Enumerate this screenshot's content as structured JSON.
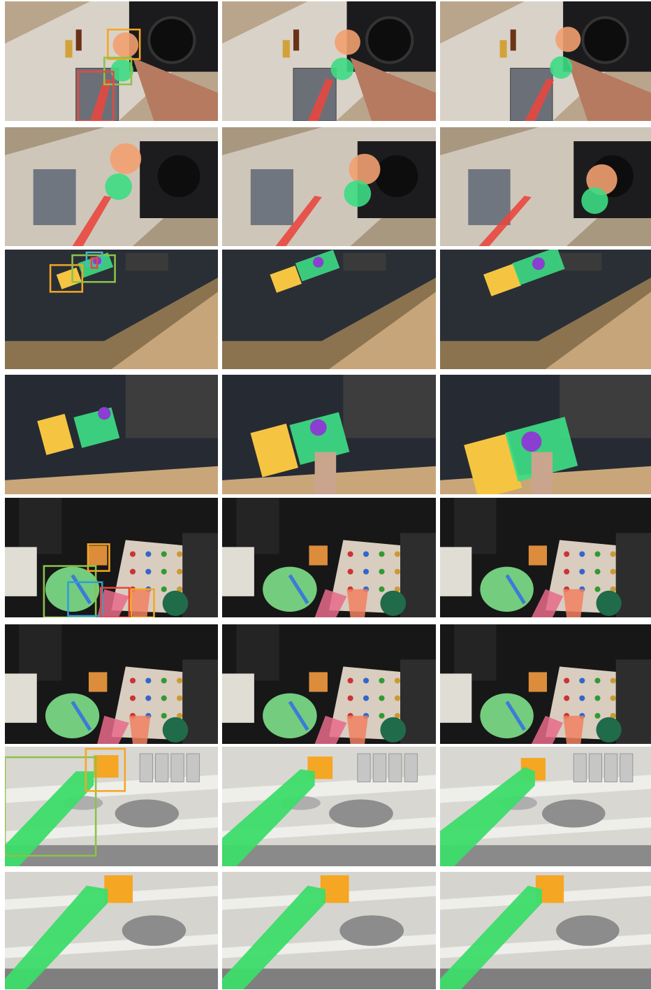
{
  "figure": {
    "rows": 8,
    "columns": 3,
    "description_rows": [
      {
        "scene": "stovetop-pan",
        "prompt_boxes": [
          "orange",
          "green",
          "red"
        ],
        "mask_colors": [
          "#f2a070",
          "#3ddc84",
          "#e8473f"
        ]
      },
      {
        "scene": "stovetop-pan-motion",
        "prompt_boxes": [],
        "mask_colors": [
          "#f2a070",
          "#3ddc84",
          "#e8473f"
        ]
      },
      {
        "scene": "countertop-board",
        "prompt_boxes": [
          "orange",
          "green",
          "cyan",
          "red"
        ],
        "mask_colors": [
          "#f5c542",
          "#3ddc84",
          "#8a3fd1",
          "#e8473f"
        ]
      },
      {
        "scene": "countertop-board-closeup",
        "prompt_boxes": [],
        "mask_colors": [
          "#f5c542",
          "#3ddc84",
          "#8a3fd1",
          "#e8473f"
        ]
      },
      {
        "scene": "dish-rack-plate",
        "prompt_boxes": [
          "orange",
          "green",
          "blue",
          "red",
          "orange"
        ],
        "mask_colors": [
          "#f29a3f",
          "#7ee08a",
          "#3b7bd9",
          "#e86a8a",
          "#f08060"
        ]
      },
      {
        "scene": "dish-rack-plate-continued",
        "prompt_boxes": [],
        "mask_colors": [
          "#f29a3f",
          "#7ee08a",
          "#3b7bd9",
          "#e86a8a",
          "#f08060"
        ]
      },
      {
        "scene": "shelf-mug-reach",
        "prompt_boxes": [
          "green",
          "orange"
        ],
        "mask_colors": [
          "#3ddc6a",
          "#f5a623"
        ]
      },
      {
        "scene": "shelf-mug-grasp",
        "prompt_boxes": [],
        "mask_colors": [
          "#3ddc6a",
          "#f5a623"
        ]
      }
    ]
  }
}
